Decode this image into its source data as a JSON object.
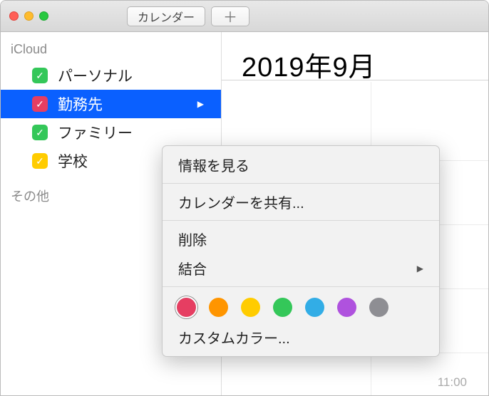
{
  "titlebar": {
    "calendars_button": "カレンダー",
    "add_button": "＋"
  },
  "sidebar": {
    "icloud_header": "iCloud",
    "items": [
      {
        "label": "パーソナル",
        "color": "#34c759"
      },
      {
        "label": "勤務先",
        "color": "#e63e62",
        "selected": true
      },
      {
        "label": "ファミリー",
        "color": "#34c759"
      },
      {
        "label": "学校",
        "color": "#ffcc00"
      }
    ],
    "other_header": "その他"
  },
  "main": {
    "title": "2019年9月",
    "time_label": "11:00"
  },
  "context_menu": {
    "view_info": "情報を見る",
    "share": "カレンダーを共有...",
    "delete": "削除",
    "merge": "結合",
    "custom_color": "カスタムカラー...",
    "colors": [
      "#e63e62",
      "#ff9500",
      "#ffcc00",
      "#34c759",
      "#32ade6",
      "#af52de",
      "#8e8e93"
    ]
  }
}
